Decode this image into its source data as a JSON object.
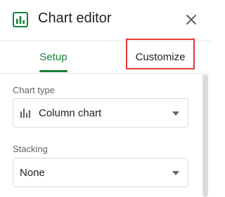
{
  "header": {
    "title": "Chart editor",
    "icon": "chart-icon",
    "close_icon": "close-icon"
  },
  "tabs": [
    {
      "label": "Setup",
      "active": true
    },
    {
      "label": "Customize",
      "active": false
    }
  ],
  "setup": {
    "chart_type": {
      "label": "Chart type",
      "value": "Column chart",
      "icon": "column-chart-icon"
    },
    "stacking": {
      "label": "Stacking",
      "value": "None"
    }
  },
  "colors": {
    "accent": "#188038",
    "highlight": "#e53935",
    "text": "#202124",
    "muted": "#5f6368",
    "border": "#dadce0"
  }
}
